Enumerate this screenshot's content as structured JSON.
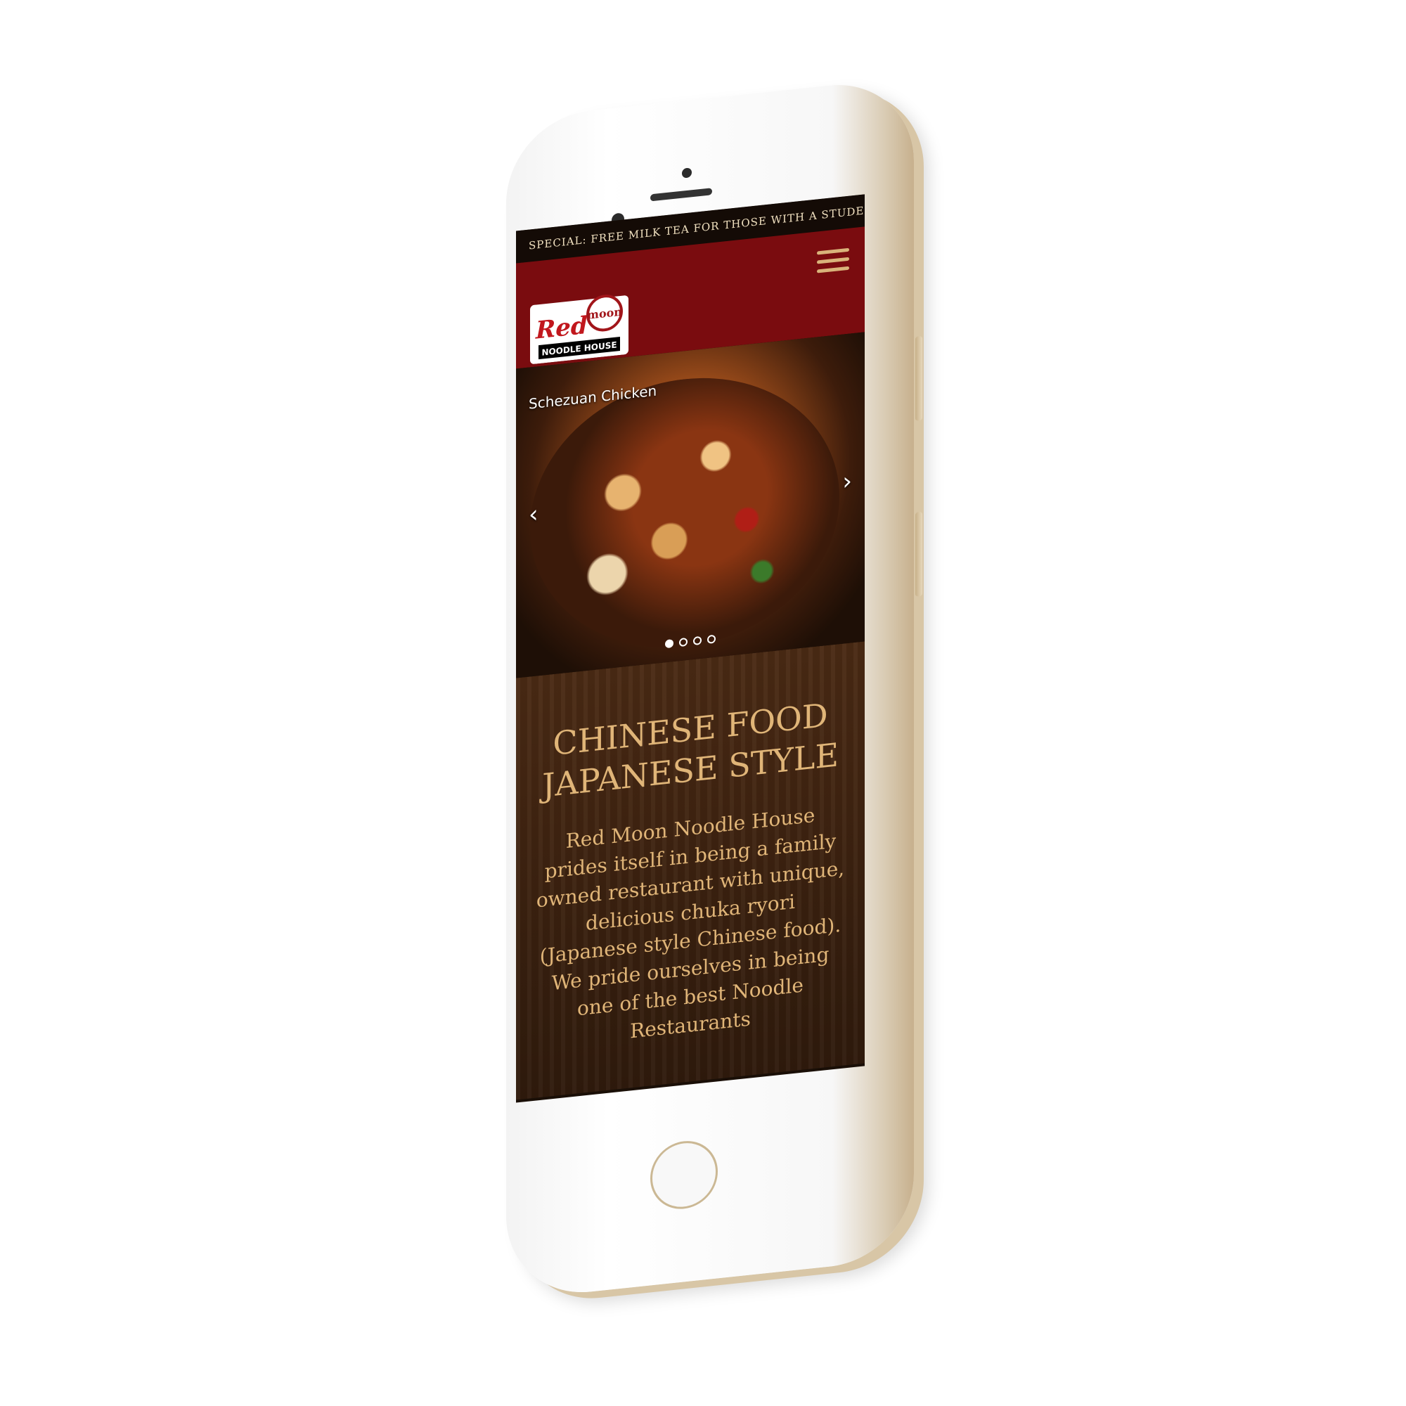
{
  "promo": {
    "text": "SPECIAL: FREE MILK TEA FOR THOSE WITH A STUDENT ID !"
  },
  "header": {
    "logo_main": "Red",
    "logo_moon": "moon",
    "logo_sub": "NOODLE HOUSE",
    "menu_icon": "hamburger-menu-icon"
  },
  "carousel": {
    "caption": "Schezuan Chicken",
    "prev_icon": "chevron-left-icon",
    "next_icon": "chevron-right-icon",
    "prev_glyph": "‹",
    "next_glyph": "›",
    "slide_count": 4,
    "active_index": 0
  },
  "content": {
    "headline_line1": "CHINESE FOOD",
    "headline_line2": "JAPANESE STYLE",
    "intro": "Red Moon Noodle House prides itself in being a family owned restaurant with unique, delicious chuka ryori (Japanese style Chinese food). We pride ourselves in being one of the best Noodle Restaurants"
  },
  "colors": {
    "brand_red": "#7a0c0f",
    "gold_text": "#e0b578",
    "promo_bg": "#140b06"
  }
}
